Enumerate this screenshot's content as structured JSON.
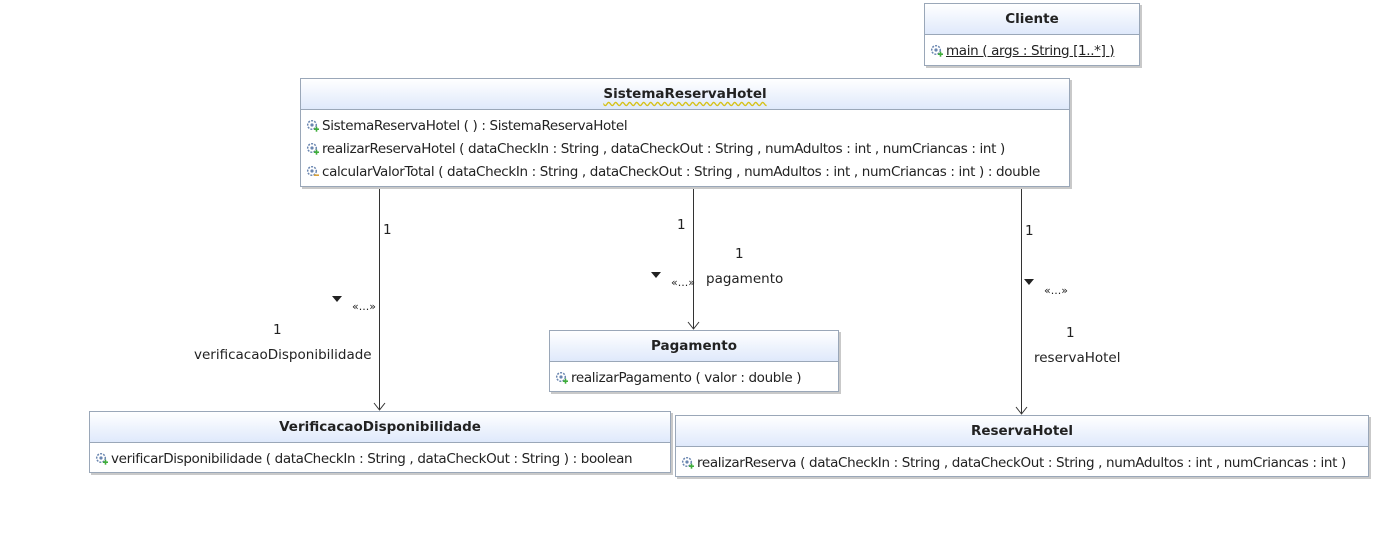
{
  "classes": {
    "cliente": {
      "name": "Cliente",
      "operations": [
        "main ( args : String [1..*] )"
      ]
    },
    "sistema": {
      "name": "SistemaReservaHotel",
      "operations": [
        "SistemaReservaHotel ( ) :  SistemaReservaHotel",
        "realizarReservaHotel ( dataCheckIn : String ,  dataCheckOut : String ,  numAdultos : int ,  numCriancas : int )",
        "calcularValorTotal ( dataCheckIn : String ,  dataCheckOut : String ,  numAdultos : int ,  numCriancas : int ) :  double"
      ]
    },
    "pagamento": {
      "name": "Pagamento",
      "operations": [
        "realizarPagamento ( valor : double )"
      ]
    },
    "verificacao": {
      "name": "VerificacaoDisponibilidade",
      "operations": [
        "verificarDisponibilidade ( dataCheckIn : String ,  dataCheckOut : String ) :  boolean"
      ]
    },
    "reserva": {
      "name": "ReservaHotel",
      "operations": [
        "realizarReserva ( dataCheckIn : String ,  dataCheckOut : String ,  numAdultos : int ,  numCriancas : int )"
      ]
    }
  },
  "associations": {
    "verificacao": {
      "source_multiplicity": "1",
      "stereotype": "«...»",
      "target_multiplicity": "1",
      "role": "verificacaoDisponibilidade"
    },
    "pagamento": {
      "source_multiplicity": "1",
      "stereotype": "«...»",
      "target_multiplicity": "1",
      "role": "pagamento"
    },
    "reserva": {
      "source_multiplicity": "1",
      "stereotype": "«...»",
      "target_multiplicity": "1",
      "role": "reservaHotel"
    }
  },
  "icons": {
    "operation": "public-operation-icon"
  },
  "colors": {
    "header_top": "#ffffff",
    "header_bottom": "#dfe9fb",
    "border": "#9aa7b8",
    "icon_gear": "#6a86b0",
    "icon_plus": "#3fae3a"
  }
}
